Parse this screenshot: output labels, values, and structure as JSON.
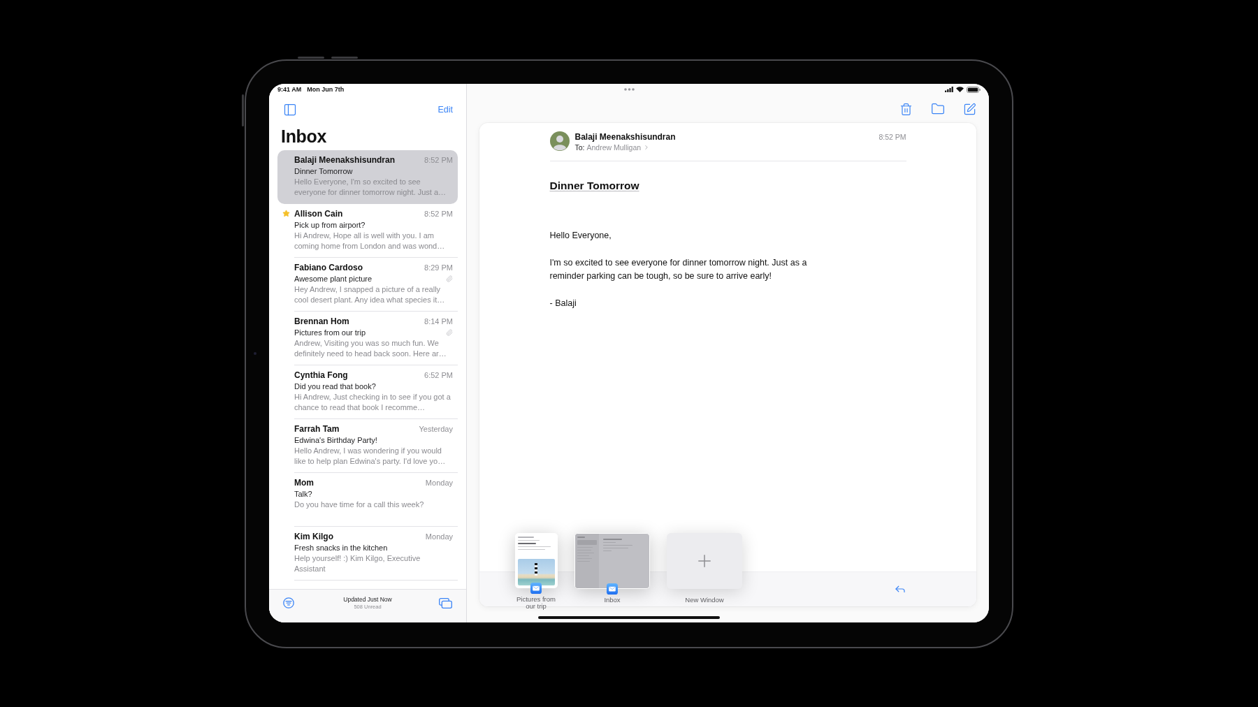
{
  "status_bar": {
    "time": "9:41 AM",
    "date": "Mon Jun 7th"
  },
  "sidebar": {
    "edit_label": "Edit",
    "title": "Inbox",
    "messages": [
      {
        "sender": "Balaji Meenakshisundran",
        "time": "8:52 PM",
        "subject": "Dinner Tomorrow",
        "preview": "Hello Everyone, I'm so excited to see everyone for dinner tomorrow night. Just a…",
        "selected": true,
        "starred": false,
        "attachment": false
      },
      {
        "sender": "Allison Cain",
        "time": "8:52 PM",
        "subject": "Pick up from airport?",
        "preview": "Hi Andrew, Hope all is well with you. I am coming home from London and was wond…",
        "selected": false,
        "starred": true,
        "attachment": false
      },
      {
        "sender": "Fabiano Cardoso",
        "time": "8:29 PM",
        "subject": "Awesome plant picture",
        "preview": "Hey Andrew, I snapped a picture of a really cool desert plant. Any idea what species it…",
        "selected": false,
        "starred": false,
        "attachment": true
      },
      {
        "sender": "Brennan Hom",
        "time": "8:14 PM",
        "subject": "Pictures from our trip",
        "preview": "Andrew, Visiting you was so much fun. We definitely need to head back soon. Here ar…",
        "selected": false,
        "starred": false,
        "attachment": true
      },
      {
        "sender": "Cynthia Fong",
        "time": "6:52 PM",
        "subject": "Did you read that book?",
        "preview": "Hi Andrew, Just checking in to see if you got a chance to read that book I recomme…",
        "selected": false,
        "starred": false,
        "attachment": false
      },
      {
        "sender": "Farrah Tam",
        "time": "Yesterday",
        "subject": "Edwina's Birthday Party!",
        "preview": "Hello Andrew, I was wondering if you would like to help plan Edwina's party. I'd love yo…",
        "selected": false,
        "starred": false,
        "attachment": false
      },
      {
        "sender": "Mom",
        "time": "Monday",
        "subject": "Talk?",
        "preview": "Do you have time for a call this week?",
        "selected": false,
        "starred": false,
        "attachment": false
      },
      {
        "sender": "Kim Kilgo",
        "time": "Monday",
        "subject": "Fresh snacks in the kitchen",
        "preview": "Help yourself! :) Kim Kilgo, Executive Assistant",
        "selected": false,
        "starred": false,
        "attachment": false
      }
    ],
    "footer": {
      "status": "Updated Just Now",
      "unread": "508 Unread"
    }
  },
  "message": {
    "sender": "Balaji Meenakshisundran",
    "to_label": "To:",
    "recipient": "Andrew Mulligan",
    "time": "8:52 PM",
    "subject": "Dinner Tomorrow",
    "body": [
      "Hello Everyone,",
      "I'm so excited to see everyone for dinner tomorrow night. Just as a reminder parking can be tough, so be sure to arrive early!",
      "- Balaji"
    ]
  },
  "window_shelf": {
    "windows": [
      {
        "kind": "message",
        "label": "Pictures from our trip"
      },
      {
        "kind": "mailbox",
        "label": "Inbox"
      },
      {
        "kind": "new",
        "label": "New Window"
      }
    ]
  }
}
